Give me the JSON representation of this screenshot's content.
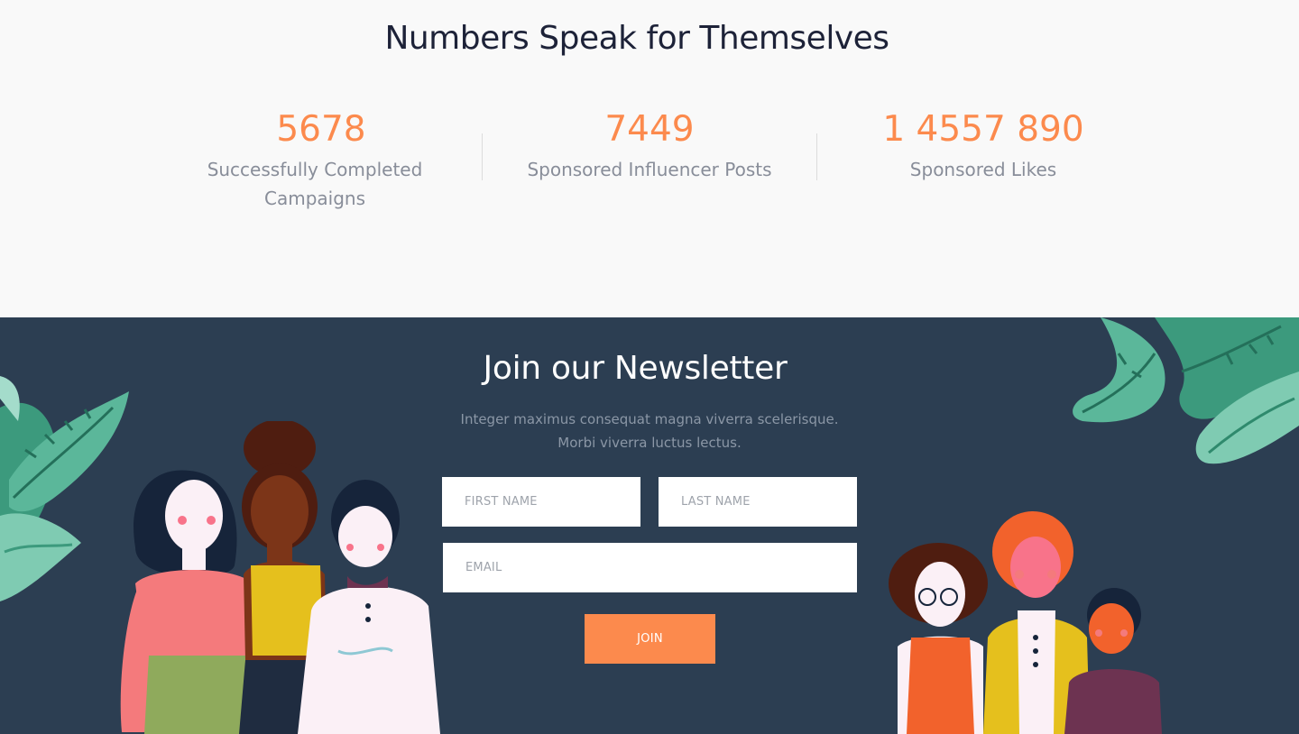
{
  "stats": {
    "title": "Numbers Speak for Themselves",
    "items": [
      {
        "value": "5678",
        "label": "Successfully Completed Campaigns"
      },
      {
        "value": "7449",
        "label": "Sponsored Influencer Posts"
      },
      {
        "value": "1 4557 890",
        "label": "Sponsored Likes"
      }
    ]
  },
  "newsletter": {
    "title": "Join our Newsletter",
    "description": "Integer maximus consequat magna viverra scelerisque. Morbi viverra luctus lectus.",
    "first_name_placeholder": "FIRST NAME",
    "last_name_placeholder": "LAST NAME",
    "email_placeholder": "EMAIL",
    "join_label": "JOIN"
  },
  "colors": {
    "accent": "#fc8a4d",
    "newsletter_bg": "#2c3e52",
    "stats_bg": "#f9f9f9",
    "heading": "#1d2238",
    "leaf_green": "#5bb79a"
  },
  "illustrations": [
    "leaf-cluster-left",
    "leaf-cluster-top-right",
    "group-of-women-left",
    "group-of-women-right"
  ]
}
